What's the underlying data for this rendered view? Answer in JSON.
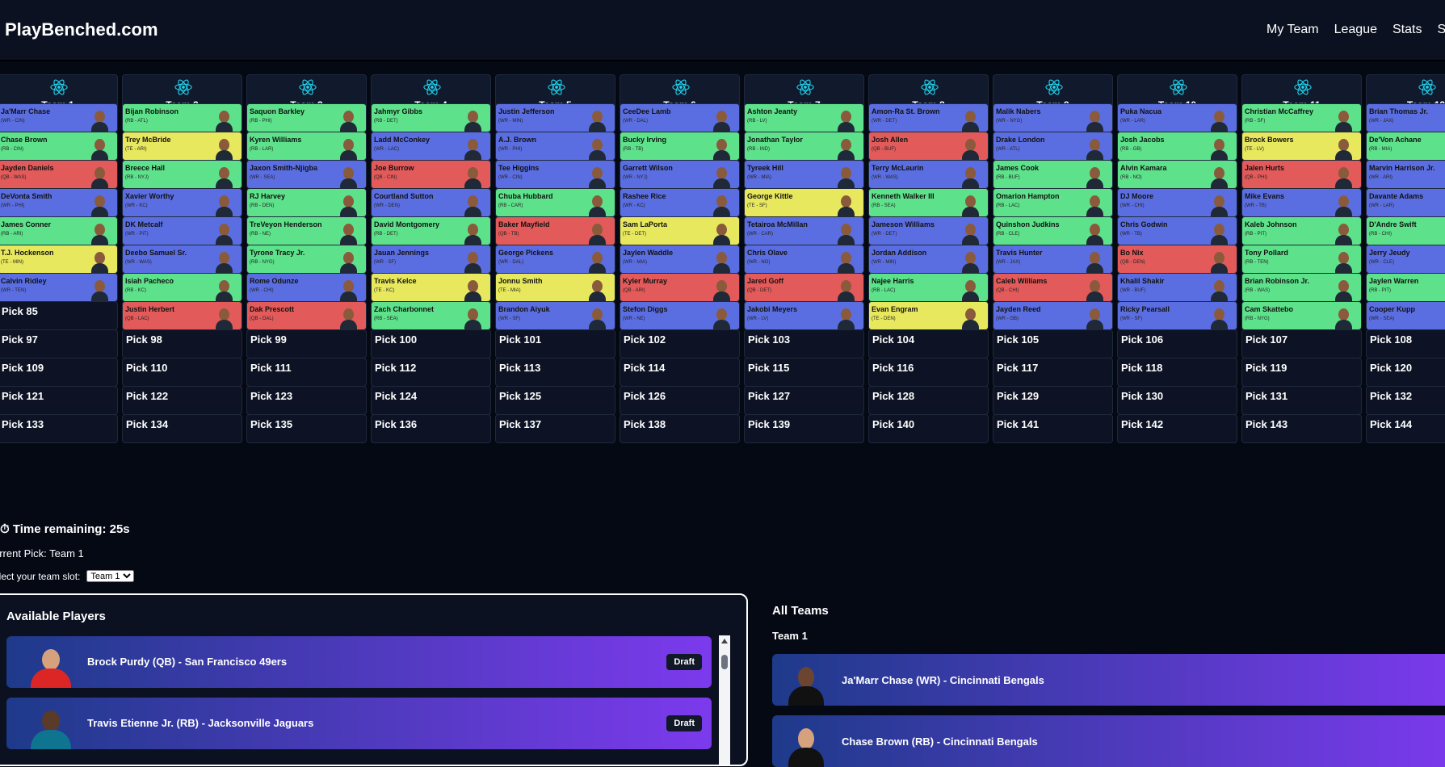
{
  "app": {
    "brand": "PlayBenched.com"
  },
  "nav": [
    "My Team",
    "League",
    "Stats",
    "S"
  ],
  "colors": {
    "WR": "#5b6ee1",
    "RB": "#5de28b",
    "QB": "#e35a5a",
    "TE": "#e8e85e",
    "empty": "#0d1324"
  },
  "teams": [
    "Team 1",
    "Team 2",
    "Team 3",
    "Team 4",
    "Team 5",
    "Team 6",
    "Team 7",
    "Team 8",
    "Team 9",
    "Team 10",
    "Team 11",
    "Team 12"
  ],
  "picks": [
    [
      {
        "n": "Ja'Marr Chase",
        "i": "(WR - CIN)",
        "p": "WR"
      },
      {
        "n": "Bijan Robinson",
        "i": "(RB - ATL)",
        "p": "RB"
      },
      {
        "n": "Saquon Barkley",
        "i": "(RB - PHI)",
        "p": "RB"
      },
      {
        "n": "Jahmyr Gibbs",
        "i": "(RB - DET)",
        "p": "RB"
      },
      {
        "n": "Justin Jefferson",
        "i": "(WR - MIN)",
        "p": "WR"
      },
      {
        "n": "CeeDee Lamb",
        "i": "(WR - DAL)",
        "p": "WR"
      },
      {
        "n": "Ashton Jeanty",
        "i": "(RB - LV)",
        "p": "RB"
      },
      {
        "n": "Amon-Ra St. Brown",
        "i": "(WR - DET)",
        "p": "WR"
      },
      {
        "n": "Malik Nabers",
        "i": "(WR - NYG)",
        "p": "WR"
      },
      {
        "n": "Puka Nacua",
        "i": "(WR - LAR)",
        "p": "WR"
      },
      {
        "n": "Christian McCaffrey",
        "i": "(RB - SF)",
        "p": "RB"
      },
      {
        "n": "Brian Thomas Jr.",
        "i": "(WR - JAX)",
        "p": "WR"
      }
    ],
    [
      {
        "n": "Chase Brown",
        "i": "(RB - CIN)",
        "p": "RB"
      },
      {
        "n": "Trey McBride",
        "i": "(TE - ARI)",
        "p": "TE"
      },
      {
        "n": "Kyren Williams",
        "i": "(RB - LAR)",
        "p": "RB"
      },
      {
        "n": "Ladd McConkey",
        "i": "(WR - LAC)",
        "p": "WR"
      },
      {
        "n": "A.J. Brown",
        "i": "(WR - PHI)",
        "p": "WR"
      },
      {
        "n": "Bucky Irving",
        "i": "(RB - TB)",
        "p": "RB"
      },
      {
        "n": "Jonathan Taylor",
        "i": "(RB - IND)",
        "p": "RB"
      },
      {
        "n": "Josh Allen",
        "i": "(QB - BUF)",
        "p": "QB"
      },
      {
        "n": "Drake London",
        "i": "(WR - ATL)",
        "p": "WR"
      },
      {
        "n": "Josh Jacobs",
        "i": "(RB - GB)",
        "p": "RB"
      },
      {
        "n": "Brock Bowers",
        "i": "(TE - LV)",
        "p": "TE"
      },
      {
        "n": "De'Von Achane",
        "i": "(RB - MIA)",
        "p": "RB"
      }
    ],
    [
      {
        "n": "Jayden Daniels",
        "i": "(QB - WAS)",
        "p": "QB"
      },
      {
        "n": "Breece Hall",
        "i": "(RB - NYJ)",
        "p": "RB"
      },
      {
        "n": "Jaxon Smith-Njigba",
        "i": "(WR - SEA)",
        "p": "WR"
      },
      {
        "n": "Joe Burrow",
        "i": "(QB - CIN)",
        "p": "QB"
      },
      {
        "n": "Tee Higgins",
        "i": "(WR - CIN)",
        "p": "WR"
      },
      {
        "n": "Garrett Wilson",
        "i": "(WR - NYJ)",
        "p": "WR"
      },
      {
        "n": "Tyreek Hill",
        "i": "(WR - MIA)",
        "p": "WR"
      },
      {
        "n": "Terry McLaurin",
        "i": "(WR - WAS)",
        "p": "WR"
      },
      {
        "n": "James Cook",
        "i": "(RB - BUF)",
        "p": "RB"
      },
      {
        "n": "Alvin Kamara",
        "i": "(RB - NO)",
        "p": "RB"
      },
      {
        "n": "Jalen Hurts",
        "i": "(QB - PHI)",
        "p": "QB"
      },
      {
        "n": "Marvin Harrison Jr.",
        "i": "(WR - ARI)",
        "p": "WR"
      }
    ],
    [
      {
        "n": "DeVonta Smith",
        "i": "(WR - PHI)",
        "p": "WR"
      },
      {
        "n": "Xavier Worthy",
        "i": "(WR - KC)",
        "p": "WR"
      },
      {
        "n": "RJ Harvey",
        "i": "(RB - DEN)",
        "p": "RB"
      },
      {
        "n": "Courtland Sutton",
        "i": "(WR - DEN)",
        "p": "WR"
      },
      {
        "n": "Chuba Hubbard",
        "i": "(RB - CAR)",
        "p": "RB"
      },
      {
        "n": "Rashee Rice",
        "i": "(WR - KC)",
        "p": "WR"
      },
      {
        "n": "George Kittle",
        "i": "(TE - SF)",
        "p": "TE"
      },
      {
        "n": "Kenneth Walker III",
        "i": "(RB - SEA)",
        "p": "RB"
      },
      {
        "n": "Omarion Hampton",
        "i": "(RB - LAC)",
        "p": "RB"
      },
      {
        "n": "DJ Moore",
        "i": "(WR - CHI)",
        "p": "WR"
      },
      {
        "n": "Mike Evans",
        "i": "(WR - TB)",
        "p": "WR"
      },
      {
        "n": "Davante Adams",
        "i": "(WR - LAR)",
        "p": "WR"
      }
    ],
    [
      {
        "n": "James Conner",
        "i": "(RB - ARI)",
        "p": "RB"
      },
      {
        "n": "DK Metcalf",
        "i": "(WR - PIT)",
        "p": "WR"
      },
      {
        "n": "TreVeyon Henderson",
        "i": "(RB - NE)",
        "p": "RB"
      },
      {
        "n": "David Montgomery",
        "i": "(RB - DET)",
        "p": "RB"
      },
      {
        "n": "Baker Mayfield",
        "i": "(QB - TB)",
        "p": "QB"
      },
      {
        "n": "Sam LaPorta",
        "i": "(TE - DET)",
        "p": "TE"
      },
      {
        "n": "Tetairoa McMillan",
        "i": "(WR - CAR)",
        "p": "WR"
      },
      {
        "n": "Jameson Williams",
        "i": "(WR - DET)",
        "p": "WR"
      },
      {
        "n": "Quinshon Judkins",
        "i": "(RB - CLE)",
        "p": "RB"
      },
      {
        "n": "Chris Godwin",
        "i": "(WR - TB)",
        "p": "WR"
      },
      {
        "n": "Kaleb Johnson",
        "i": "(RB - PIT)",
        "p": "RB"
      },
      {
        "n": "D'Andre Swift",
        "i": "(RB - CHI)",
        "p": "RB"
      }
    ],
    [
      {
        "n": "T.J. Hockenson",
        "i": "(TE - MIN)",
        "p": "TE"
      },
      {
        "n": "Deebo Samuel Sr.",
        "i": "(WR - WAS)",
        "p": "WR"
      },
      {
        "n": "Tyrone Tracy Jr.",
        "i": "(RB - NYG)",
        "p": "RB"
      },
      {
        "n": "Jauan Jennings",
        "i": "(WR - SF)",
        "p": "WR"
      },
      {
        "n": "George Pickens",
        "i": "(WR - DAL)",
        "p": "WR"
      },
      {
        "n": "Jaylen Waddle",
        "i": "(WR - MIA)",
        "p": "WR"
      },
      {
        "n": "Chris Olave",
        "i": "(WR - NO)",
        "p": "WR"
      },
      {
        "n": "Jordan Addison",
        "i": "(WR - MIN)",
        "p": "WR"
      },
      {
        "n": "Travis Hunter",
        "i": "(WR - JAX)",
        "p": "WR"
      },
      {
        "n": "Bo Nix",
        "i": "(QB - DEN)",
        "p": "QB"
      },
      {
        "n": "Tony Pollard",
        "i": "(RB - TEN)",
        "p": "RB"
      },
      {
        "n": "Jerry Jeudy",
        "i": "(WR - CLE)",
        "p": "WR"
      }
    ],
    [
      {
        "n": "Calvin Ridley",
        "i": "(WR - TEN)",
        "p": "WR"
      },
      {
        "n": "Isiah Pacheco",
        "i": "(RB - KC)",
        "p": "RB"
      },
      {
        "n": "Rome Odunze",
        "i": "(WR - CHI)",
        "p": "WR"
      },
      {
        "n": "Travis Kelce",
        "i": "(TE - KC)",
        "p": "TE"
      },
      {
        "n": "Jonnu Smith",
        "i": "(TE - MIA)",
        "p": "TE"
      },
      {
        "n": "Kyler Murray",
        "i": "(QB - ARI)",
        "p": "QB"
      },
      {
        "n": "Jared Goff",
        "i": "(QB - DET)",
        "p": "QB"
      },
      {
        "n": "Najee Harris",
        "i": "(RB - LAC)",
        "p": "RB"
      },
      {
        "n": "Caleb Williams",
        "i": "(QB - CHI)",
        "p": "QB"
      },
      {
        "n": "Khalil Shakir",
        "i": "(WR - BUF)",
        "p": "WR"
      },
      {
        "n": "Brian Robinson Jr.",
        "i": "(RB - WAS)",
        "p": "RB"
      },
      {
        "n": "Jaylen Warren",
        "i": "(RB - PIT)",
        "p": "RB"
      }
    ],
    [
      {
        "pick": "Pick 85"
      },
      {
        "n": "Justin Herbert",
        "i": "(QB - LAC)",
        "p": "QB"
      },
      {
        "n": "Dak Prescott",
        "i": "(QB - DAL)",
        "p": "QB"
      },
      {
        "n": "Zach Charbonnet",
        "i": "(RB - SEA)",
        "p": "RB"
      },
      {
        "n": "Brandon Aiyuk",
        "i": "(WR - SF)",
        "p": "WR"
      },
      {
        "n": "Stefon Diggs",
        "i": "(WR - NE)",
        "p": "WR"
      },
      {
        "n": "Jakobi Meyers",
        "i": "(WR - LV)",
        "p": "WR"
      },
      {
        "n": "Evan Engram",
        "i": "(TE - DEN)",
        "p": "TE"
      },
      {
        "n": "Jayden Reed",
        "i": "(WR - GB)",
        "p": "WR"
      },
      {
        "n": "Ricky Pearsall",
        "i": "(WR - SF)",
        "p": "WR"
      },
      {
        "n": "Cam Skattebo",
        "i": "(RB - NYG)",
        "p": "RB"
      },
      {
        "n": "Cooper Kupp",
        "i": "(WR - SEA)",
        "p": "WR"
      }
    ],
    [
      {
        "pick": "Pick 97"
      },
      {
        "pick": "Pick 98"
      },
      {
        "pick": "Pick 99"
      },
      {
        "pick": "Pick 100"
      },
      {
        "pick": "Pick 101"
      },
      {
        "pick": "Pick 102"
      },
      {
        "pick": "Pick 103"
      },
      {
        "pick": "Pick 104"
      },
      {
        "pick": "Pick 105"
      },
      {
        "pick": "Pick 106"
      },
      {
        "pick": "Pick 107"
      },
      {
        "pick": "Pick 108"
      }
    ],
    [
      {
        "pick": "Pick 109"
      },
      {
        "pick": "Pick 110"
      },
      {
        "pick": "Pick 111"
      },
      {
        "pick": "Pick 112"
      },
      {
        "pick": "Pick 113"
      },
      {
        "pick": "Pick 114"
      },
      {
        "pick": "Pick 115"
      },
      {
        "pick": "Pick 116"
      },
      {
        "pick": "Pick 117"
      },
      {
        "pick": "Pick 118"
      },
      {
        "pick": "Pick 119"
      },
      {
        "pick": "Pick 120"
      }
    ],
    [
      {
        "pick": "Pick 121"
      },
      {
        "pick": "Pick 122"
      },
      {
        "pick": "Pick 123"
      },
      {
        "pick": "Pick 124"
      },
      {
        "pick": "Pick 125"
      },
      {
        "pick": "Pick 126"
      },
      {
        "pick": "Pick 127"
      },
      {
        "pick": "Pick 128"
      },
      {
        "pick": "Pick 129"
      },
      {
        "pick": "Pick 130"
      },
      {
        "pick": "Pick 131"
      },
      {
        "pick": "Pick 132"
      }
    ],
    [
      {
        "pick": "Pick 133"
      },
      {
        "pick": "Pick 134"
      },
      {
        "pick": "Pick 135"
      },
      {
        "pick": "Pick 136"
      },
      {
        "pick": "Pick 137"
      },
      {
        "pick": "Pick 138"
      },
      {
        "pick": "Pick 139"
      },
      {
        "pick": "Pick 140"
      },
      {
        "pick": "Pick 141"
      },
      {
        "pick": "Pick 142"
      },
      {
        "pick": "Pick 143"
      },
      {
        "pick": "Pick 144"
      }
    ]
  ],
  "draft": {
    "timer_icon": "clock-icon",
    "time_remaining": "Time remaining: 25s",
    "current_pick": "urrent Pick: Team 1",
    "slot_label": "elect your team slot:",
    "slot_selected": "Team 1"
  },
  "available": {
    "title": "Available Players",
    "players": [
      {
        "label": "Brock Purdy (QB) - San Francisco 49ers",
        "button": "Draft"
      },
      {
        "label": "Travis Etienne Jr. (RB) - Jacksonville Jaguars",
        "button": "Draft"
      }
    ]
  },
  "all_teams": {
    "title": "All Teams",
    "team": "Team 1",
    "players": [
      "Ja'Marr Chase (WR) - Cincinnati Bengals",
      "Chase Brown (RB) - Cincinnati Bengals"
    ]
  }
}
